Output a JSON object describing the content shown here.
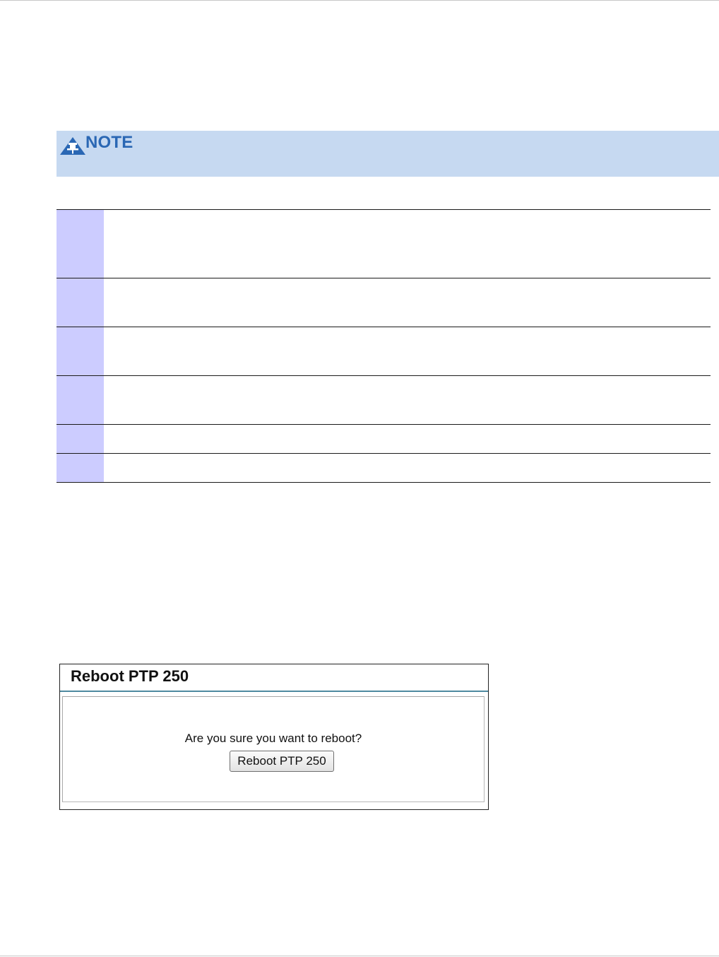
{
  "note": {
    "label": "NOTE",
    "icon": "note-pin-icon",
    "colors": {
      "background": "#c6d9f1",
      "label": "#2a67b4",
      "icon": "#2a67b4"
    }
  },
  "steps_table": {
    "row_count": 6,
    "colors": {
      "number_cell": "#ccccff",
      "rule": "#1a1a1a"
    }
  },
  "dialog": {
    "title": "Reboot PTP 250",
    "question": "Are you sure you want to reboot?",
    "button_label": "Reboot PTP 250",
    "colors": {
      "title_rule": "#4f8aa0"
    }
  }
}
